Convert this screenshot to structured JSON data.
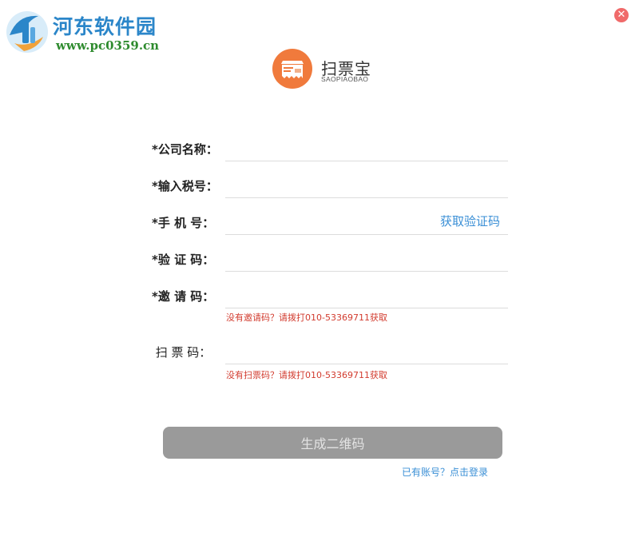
{
  "watermark": {
    "title": "河东软件园",
    "url": "www.pc0359.cn"
  },
  "window": {
    "close_icon": "close-icon"
  },
  "brand": {
    "name": "扫票宝",
    "subtitle": "SAOPIAOBAO",
    "logo_text": "扫票宝",
    "accent_color": "#f07a3c"
  },
  "form": {
    "company": {
      "label": "*公司名称：",
      "value": ""
    },
    "tax": {
      "label": "*输入税号：",
      "value": ""
    },
    "phone": {
      "label": "*手 机 号：",
      "value": "",
      "action_label": "获取验证码"
    },
    "code": {
      "label": "*验 证 码：",
      "value": ""
    },
    "invite": {
      "label": "*邀 请 码：",
      "value": "",
      "hint": "没有邀请码？请拨打010-53369711获取"
    },
    "scan": {
      "label": " 扫 票 码：",
      "value": "",
      "hint": "没有扫票码？请拨打010-53369711获取"
    }
  },
  "actions": {
    "generate_label": "生成二维码",
    "login_label": "已有账号？点击登录"
  },
  "colors": {
    "link": "#3a8fd6",
    "hint": "#d23b2e",
    "button": "#9a9a9a"
  }
}
